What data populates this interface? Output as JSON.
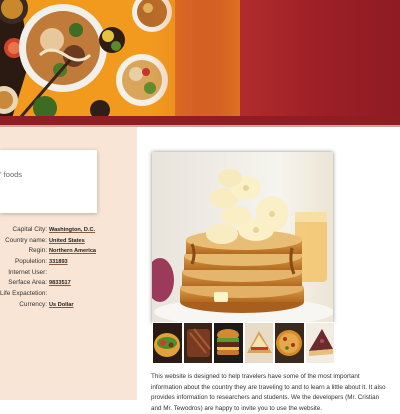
{
  "search": {
    "placeholder": "tries' foods"
  },
  "country_info": {
    "rows": [
      {
        "label": "Capital City:",
        "value": "Washington, D.C."
      },
      {
        "label": "Country name:",
        "value": "United States"
      },
      {
        "label": "Regin:",
        "value": "Northern America"
      },
      {
        "label": "Populetion:",
        "value": "331893"
      },
      {
        "label": "Internet User:",
        "value": ""
      },
      {
        "label": "Serface Area:",
        "value": "9833517"
      },
      {
        "label": "Life Expactetion:",
        "value": ""
      },
      {
        "label": "Currency:",
        "value": "Us Dollar"
      }
    ]
  },
  "gallery": {
    "main_image": "pancakes-with-banana",
    "thumbnails": [
      "taco",
      "ribs",
      "burger",
      "sandwich",
      "pizza",
      "pie"
    ]
  },
  "description": "This website is designed to help travelers have some of the most important information about the country they are traveling to and to learn a little about it. It also provides information to researchers and students. We the developers (Mr. Cristian and Mr. Tewodros) are happy to invite you to use the website.",
  "colors": {
    "banner_orange": "#f39a1c",
    "banner_red": "#9e1f26",
    "panel_peach": "#f9e5d6",
    "stripe": "#8f1e24"
  }
}
